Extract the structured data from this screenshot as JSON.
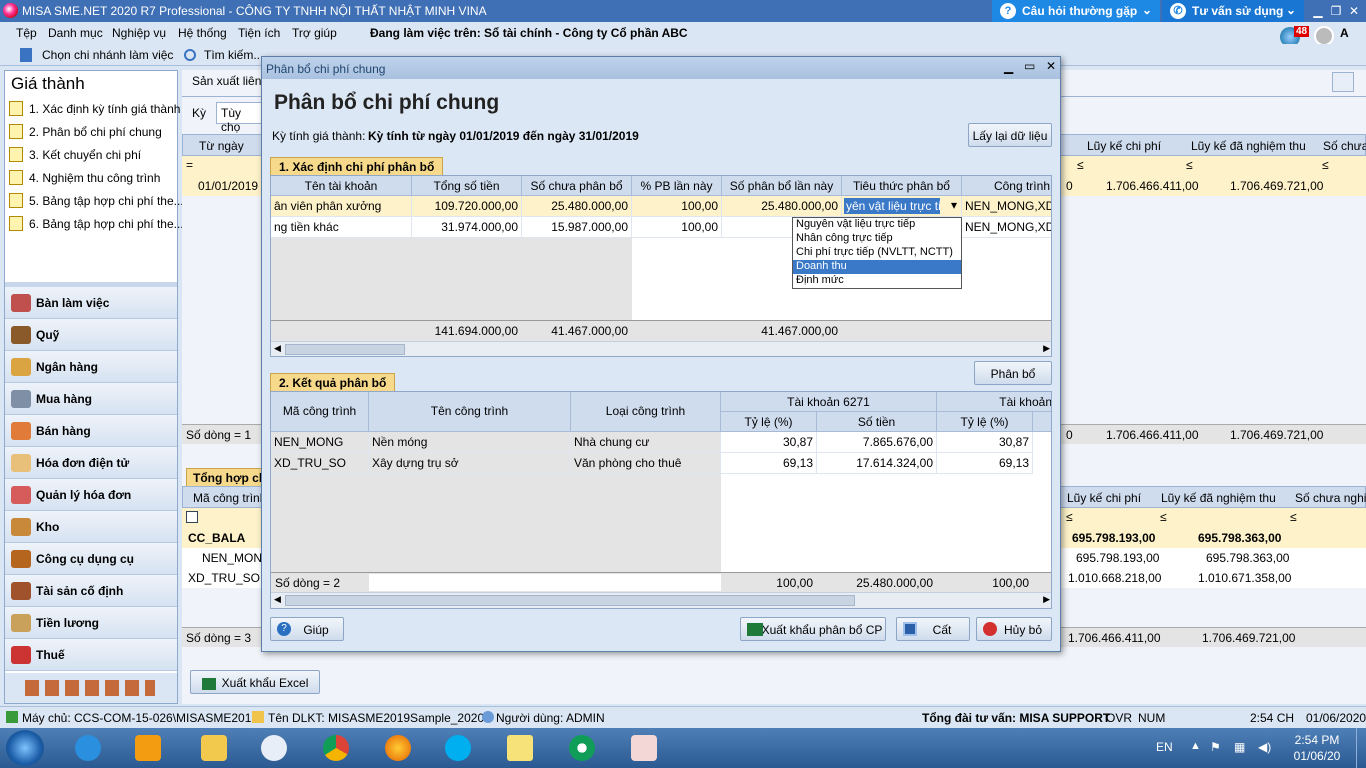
{
  "window": {
    "title": "MISA SME.NET 2020 R7 Professional - CÔNG TY TNHH NỘI THẤT NHẬT MINH VINA",
    "help_faq": "Câu hỏi thường gặp",
    "help_consult": "Tư vấn sử dụng",
    "badge_count": "48",
    "user_initial": "A"
  },
  "menu": {
    "items": [
      "Tệp",
      "Danh mục",
      "Nghiệp vụ",
      "Hệ thống",
      "Tiện ích",
      "Trợ giúp"
    ],
    "workspace": "Đang làm việc trên: Sổ tài chính - Công ty Cổ phần ABC"
  },
  "toolbar": {
    "branch": "Chọn chi nhánh làm việc",
    "search": "Tìm kiếm..."
  },
  "sidebar": {
    "title": "Giá thành",
    "items": [
      "1. Xác định kỳ tính giá thành",
      "2. Phân bổ chi phí chung",
      "3. Kết chuyển chi phí",
      "4. Nghiệm thu công trình",
      "5. Bảng tập hợp chi phí the...",
      "6. Bảng tập hợp chi phí the..."
    ],
    "modules": [
      "Bàn làm việc",
      "Quỹ",
      "Ngân hàng",
      "Mua hàng",
      "Bán hàng",
      "Hóa đơn điện tử",
      "Quản lý hóa đơn",
      "Kho",
      "Công cụ dụng cụ",
      "Tài sản cố định",
      "Tiền lương",
      "Thuế"
    ]
  },
  "background": {
    "tab": "Sản xuất liên t",
    "ky_label": "Kỳ",
    "ky_value": "Tùy chọ",
    "col_tu_ngay": "Từ ngày",
    "row_date": "01/01/2019",
    "col_luy_ke": "Lũy kế chi phí",
    "col_luy_ke_nt": "Lũy kế đã nghiệm thu",
    "col_so_chua": "Số chưa",
    "col_so_chua_full": "Số chưa nghiệ",
    "row1_luyke": "1.706.466.411,00",
    "row1_luykent": "1.706.469.721,00",
    "row_zero": "0",
    "so_dong_1": "Số dòng = 1",
    "tong_hop": "Tổng hợp chi",
    "ma_cong_trinh": "Mã công trình",
    "cc_bala": "CC_BALA",
    "cc_luyke": "695.798.193,00",
    "cc_luykent": "695.798.363,00",
    "nen_mong": "NEN_MONG",
    "nen_luyke": "695.798.193,00",
    "nen_luykent": "695.798.363,00",
    "xd_tru_so": "XD_TRU_SO",
    "xd_luyke": "1.010.668.218,00",
    "xd_luykent": "1.010.671.358,00",
    "so_dong_3": "Số dòng = 3",
    "total_luyke": "1.706.466.411,00",
    "total_luykent": "1.706.469.721,00",
    "export_excel": "Xuất khẩu Excel"
  },
  "dialog": {
    "window_title": "Phân bổ chi phí chung",
    "heading": "Phân bổ chi phí chung",
    "period_label": "Kỳ tính giá thành:",
    "period_value": "Kỳ tính từ ngày 01/01/2019 đến ngày 31/01/2019",
    "reload_button": "Lấy lại dữ liệu",
    "section1": "1. Xác định chi phí phân bổ",
    "section2": "2. Kết quả phân bổ",
    "allocate_button": "Phân bổ",
    "grid1": {
      "headers": [
        "Tên tài khoản",
        "Tổng số tiền",
        "Số chưa phân bổ",
        "% PB lần này",
        "Số phân bổ lần này",
        "Tiêu thức phân bổ",
        "Công trình"
      ],
      "rows": [
        {
          "name": "ân viên phân xưởng",
          "total": "109.720.000,00",
          "unallocated": "25.480.000,00",
          "pct": "100,00",
          "allocated": "25.480.000,00",
          "criteria": "yên vật liệu trực tiếp",
          "projects": "NEN_MONG,XD_"
        },
        {
          "name": "ng tiền khác",
          "total": "31.974.000,00",
          "unallocated": "15.987.000,00",
          "pct": "100,00",
          "allocated": "15.9",
          "criteria": "",
          "projects": "NEN_MONG,XD_"
        }
      ],
      "footer": {
        "total": "141.694.000,00",
        "unallocated": "41.467.000,00",
        "allocated": "41.467.000,00"
      }
    },
    "dropdown_options": [
      "Nguyên vật liệu trực tiếp",
      "Nhân công trực tiếp",
      "Chi phí trực tiếp (NVLTT, NCTT)",
      "Doanh thu",
      "Định mức"
    ],
    "dropdown_selected": "Doanh thu",
    "grid2": {
      "headers": {
        "code": "Mã công trình",
        "name": "Tên công trình",
        "type": "Loại công trình",
        "account": "Tài khoản 6271",
        "account2": "Tài khoản",
        "ratio": "Tỷ lệ (%)",
        "amount": "Số tiền",
        "ratio2": "Tỷ lệ (%)"
      },
      "rows": [
        {
          "code": "NEN_MONG",
          "name": "Nền móng",
          "type": "Nhà chung cư",
          "ratio": "30,87",
          "amount": "7.865.676,00",
          "ratio2": "30,87"
        },
        {
          "code": "XD_TRU_SO",
          "name": "Xây dựng trụ sở",
          "type": "Văn phòng cho thuê",
          "ratio": "69,13",
          "amount": "17.614.324,00",
          "ratio2": "69,13"
        }
      ],
      "footer": {
        "count": "Số dòng = 2",
        "ratio": "100,00",
        "amount": "25.480.000,00",
        "ratio2": "100,00"
      }
    },
    "help_button": "Giúp",
    "export_button": "Xuất khẩu phân bổ CP",
    "save_button": "Cất",
    "cancel_button": "Hủy bỏ"
  },
  "statusbar": {
    "server": "Máy chủ: CCS-COM-15-026\\MISASME2019",
    "db": "Tên DLKT: MISASME2019Sample_2020",
    "user": "Người dùng: ADMIN",
    "hotline": "Tổng đài tư vấn: MISA SUPPORT",
    "ovr": "OVR",
    "num": "NUM",
    "time": "2:54 CH",
    "date": "01/06/2020"
  },
  "taskbar": {
    "lang": "EN",
    "time": "2:54 PM",
    "date": "01/06/20"
  }
}
